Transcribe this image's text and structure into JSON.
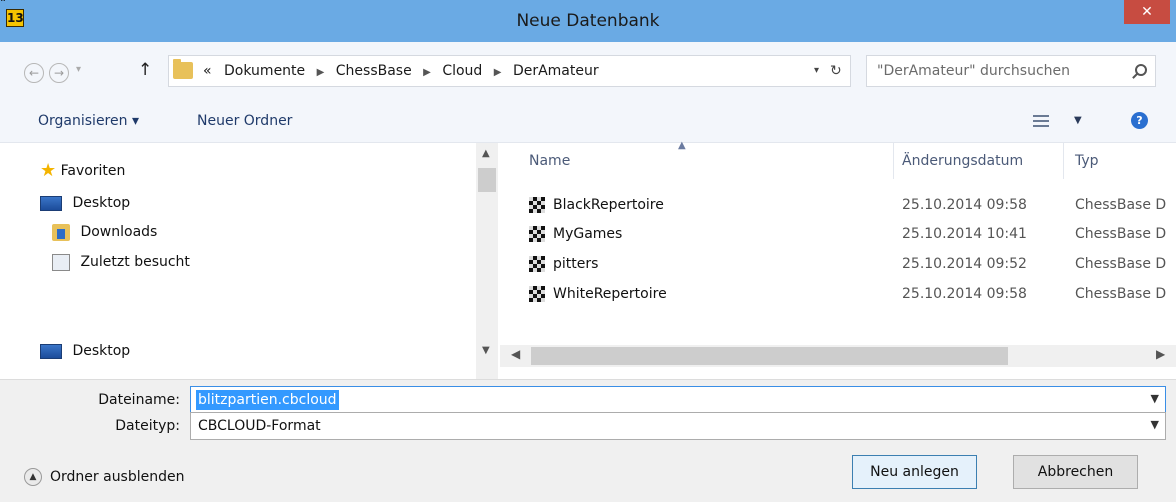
{
  "window": {
    "title": "Neue Datenbank",
    "app_icon_label": "13",
    "title_mark": "\"",
    "close_label": "✕"
  },
  "address": {
    "crumbs": [
      "«",
      "Dokumente",
      "ChessBase",
      "Cloud",
      "DerAmateur"
    ],
    "search_placeholder": "\"DerAmateur\" durchsuchen"
  },
  "toolbar": {
    "organize_label": "Organisieren ▾",
    "new_folder_label": "Neuer Ordner",
    "help_label": "?"
  },
  "nav": {
    "items": [
      {
        "label": "Favoriten",
        "icon": "star-icon"
      },
      {
        "label": "Desktop",
        "icon": "desktop-icon"
      },
      {
        "label": "Downloads",
        "icon": "downloads-folder-icon"
      },
      {
        "label": "Zuletzt besucht",
        "icon": "recent-places-icon"
      },
      {
        "label": "Desktop",
        "icon": "desktop-icon"
      }
    ]
  },
  "filelist": {
    "columns": [
      "Name",
      "Änderungsdatum",
      "Typ"
    ],
    "rows": [
      {
        "name": "BlackRepertoire",
        "date": "25.10.2014 09:58",
        "type": "ChessBase D"
      },
      {
        "name": "MyGames",
        "date": "25.10.2014 10:41",
        "type": "ChessBase D"
      },
      {
        "name": "pitters",
        "date": "25.10.2014 09:52",
        "type": "ChessBase D"
      },
      {
        "name": "WhiteRepertoire",
        "date": "25.10.2014 09:58",
        "type": "ChessBase D"
      }
    ]
  },
  "form": {
    "filename_label": "Dateiname:",
    "filename_value": "blitzpartien.cbcloud",
    "filetype_label": "Dateityp:",
    "filetype_value": "CBCLOUD-Format",
    "hide_folders_label": "Ordner ausblenden",
    "create_label": "Neu anlegen",
    "cancel_label": "Abbrechen"
  },
  "colors": {
    "titlebar": "#6aaae4",
    "close": "#c74c41",
    "selection": "#3399ff"
  }
}
